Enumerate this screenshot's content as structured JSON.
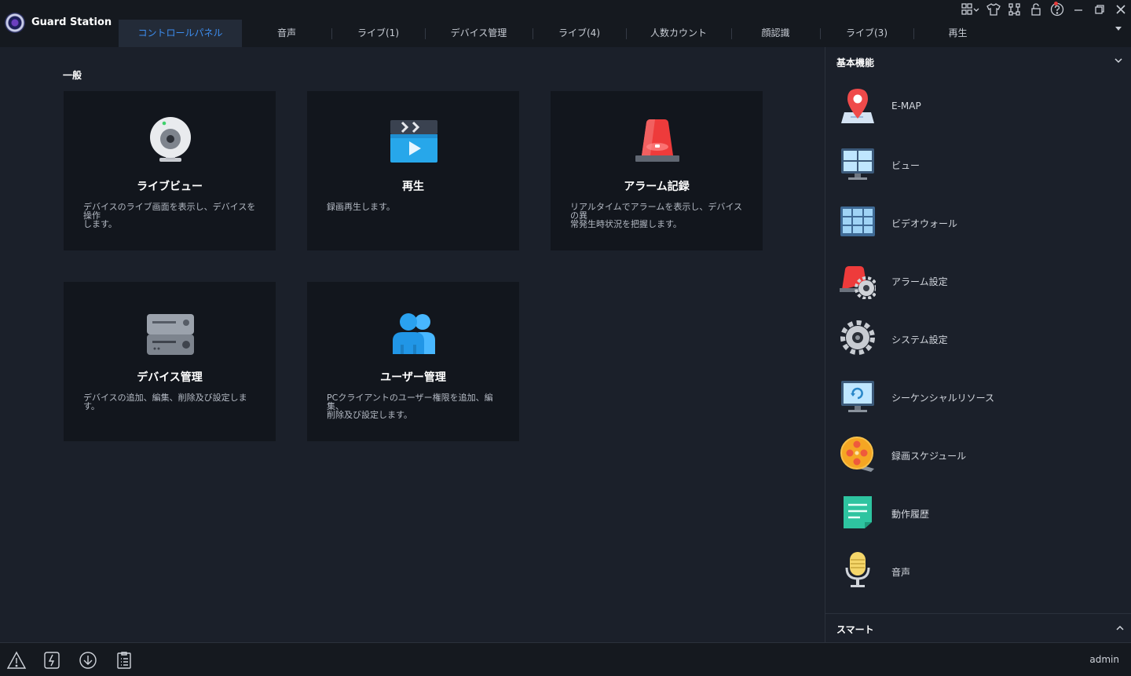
{
  "app": {
    "title": "Guard Station"
  },
  "tabs": [
    {
      "label": "コントロールパネル",
      "active": true
    },
    {
      "label": "音声"
    },
    {
      "label": "ライブ(1)"
    },
    {
      "label": "デバイス管理"
    },
    {
      "label": "ライブ(4)"
    },
    {
      "label": "人数カウント"
    },
    {
      "label": "顔認識"
    },
    {
      "label": "ライブ(3)"
    },
    {
      "label": "再生"
    }
  ],
  "window_controls": [
    "layout-grid-icon",
    "skin-shirt-icon",
    "network-icon",
    "lock-icon",
    "help-icon",
    "minimize-icon",
    "restore-icon",
    "close-icon"
  ],
  "main": {
    "section_label": "一般",
    "cards": [
      {
        "icon": "camera-icon",
        "title": "ライブビュー",
        "desc_lines": [
          "デバイスのライブ画面を表示し、デバイスを操作",
          "します。"
        ]
      },
      {
        "icon": "playback-icon",
        "title": "再生",
        "desc_lines": [
          "録画再生します。"
        ]
      },
      {
        "icon": "alarm-light-icon",
        "title": "アラーム記録",
        "desc_lines": [
          "リアルタイムでアラームを表示し、デバイスの異",
          "常発生時状況を把握します。"
        ]
      },
      {
        "icon": "device-server-icon",
        "title": "デバイス管理",
        "desc_lines": [
          "デバイスの追加、編集、削除及び設定します。"
        ]
      },
      {
        "icon": "users-icon",
        "title": "ユーザー管理",
        "desc_lines": [
          "PCクライアントのユーザー権限を追加、編集、",
          "削除及び設定します。"
        ]
      }
    ]
  },
  "right_panel": {
    "heading": "基本機能",
    "items": [
      {
        "icon": "map-pin-icon",
        "label": "E-MAP"
      },
      {
        "icon": "view-monitor-icon",
        "label": "ビュー"
      },
      {
        "icon": "video-wall-icon",
        "label": "ビデオウォール"
      },
      {
        "icon": "alarm-settings-icon",
        "label": "アラーム設定"
      },
      {
        "icon": "system-gear-icon",
        "label": "システム設定"
      },
      {
        "icon": "sequence-monitor-icon",
        "label": "シーケンシャルリソース"
      },
      {
        "icon": "film-reel-icon",
        "label": "録画スケジュール"
      },
      {
        "icon": "document-log-icon",
        "label": "動作履歴"
      },
      {
        "icon": "microphone-icon",
        "label": "音声"
      }
    ],
    "smart_label": "スマート"
  },
  "bottom_bar": {
    "buttons": [
      "warning-icon",
      "power-alert-icon",
      "download-icon",
      "task-list-icon"
    ],
    "user": "admin"
  },
  "colors": {
    "accent": "#3d8ef0",
    "background": "#1b202a",
    "card": "#12161d",
    "titlebar": "#15191f"
  }
}
